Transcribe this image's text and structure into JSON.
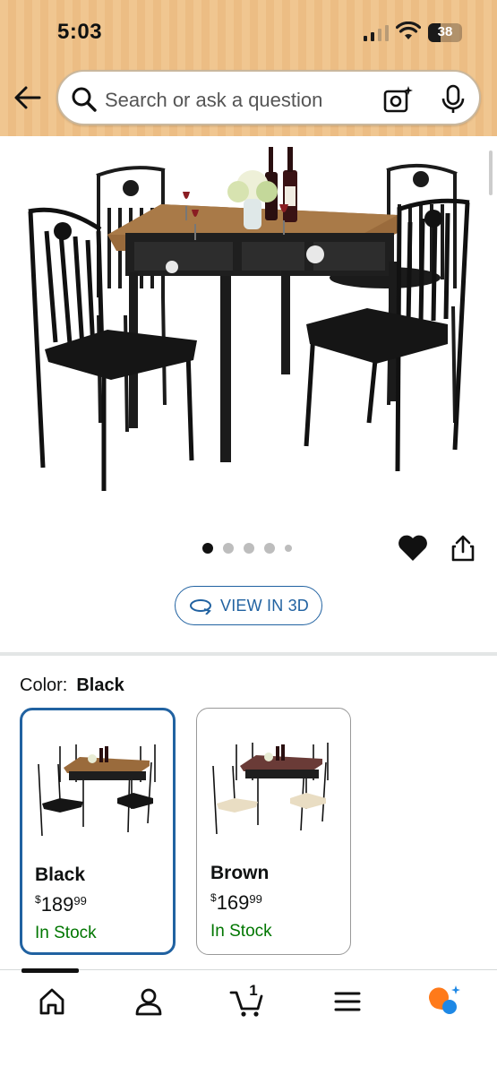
{
  "status_bar": {
    "time": "5:03",
    "battery": "38",
    "battery_level": 0.38
  },
  "search": {
    "placeholder": "Search or ask a question"
  },
  "product": {
    "images_count": 5,
    "active_image": 1
  },
  "view_3d": {
    "label": "VIEW IN 3D"
  },
  "color_selector": {
    "label": "Color:",
    "selected": "Black",
    "options": [
      {
        "name": "Black",
        "currency": "$",
        "dollars": "189",
        "cents": "99",
        "stock": "In Stock",
        "selected": true
      },
      {
        "name": "Brown",
        "currency": "$",
        "dollars": "169",
        "cents": "99",
        "stock": "In Stock",
        "selected": false
      }
    ]
  },
  "bottom_nav": {
    "items": [
      "home-icon",
      "account-icon",
      "cart-icon",
      "menu-icon",
      "rufus-icon"
    ],
    "cart_count": "1",
    "active": "home"
  },
  "colors": {
    "accent": "#2162a1",
    "in_stock": "#007600",
    "header_bg": "#f0c690",
    "table_top_rustic": "#9a6b3c",
    "table_top_brown": "#6a3b37"
  }
}
